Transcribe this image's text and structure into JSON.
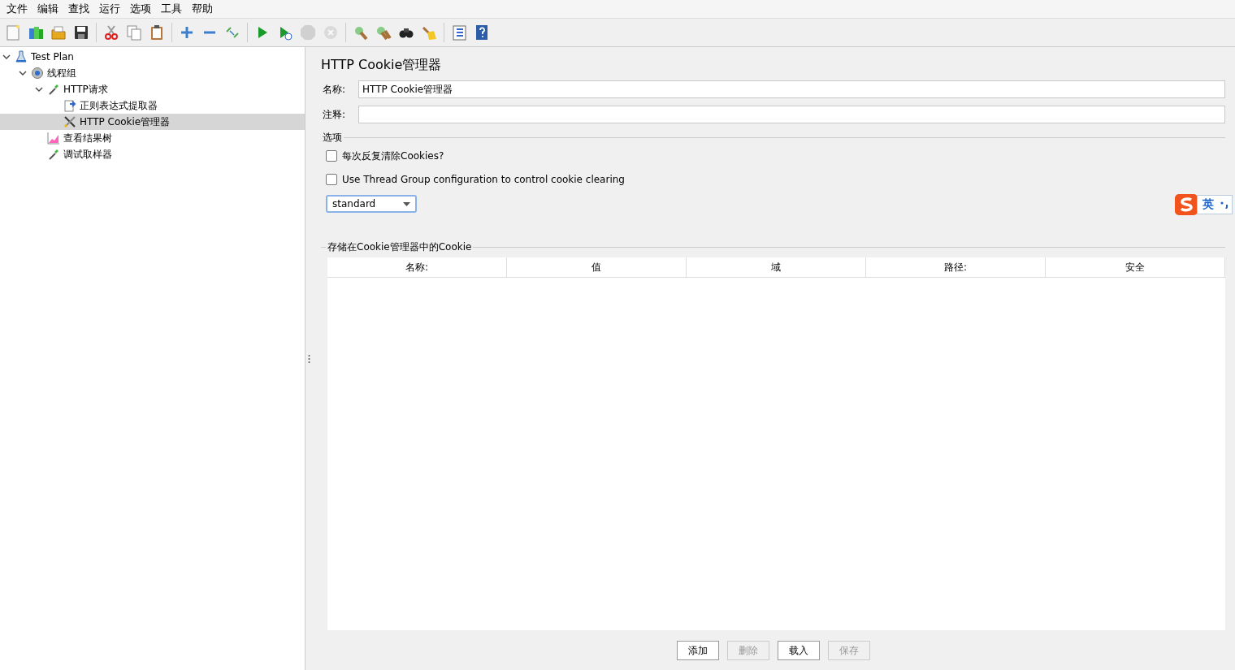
{
  "menu": [
    "文件",
    "编辑",
    "查找",
    "运行",
    "选项",
    "工具",
    "帮助"
  ],
  "toolbar": [
    {
      "kind": "new",
      "disabled": false
    },
    {
      "kind": "templates",
      "disabled": false
    },
    {
      "kind": "open",
      "disabled": false
    },
    {
      "kind": "save",
      "disabled": false
    },
    {
      "kind": "sep"
    },
    {
      "kind": "cut",
      "disabled": false
    },
    {
      "kind": "copy",
      "disabled": false
    },
    {
      "kind": "paste",
      "disabled": false
    },
    {
      "kind": "sep"
    },
    {
      "kind": "expand",
      "disabled": false
    },
    {
      "kind": "collapse",
      "disabled": false
    },
    {
      "kind": "toggle",
      "disabled": false
    },
    {
      "kind": "sep"
    },
    {
      "kind": "start",
      "disabled": false
    },
    {
      "kind": "start-no-pause",
      "disabled": false
    },
    {
      "kind": "stop",
      "disabled": true
    },
    {
      "kind": "shutdown",
      "disabled": true
    },
    {
      "kind": "sep"
    },
    {
      "kind": "clear",
      "disabled": false
    },
    {
      "kind": "clear-all",
      "disabled": false
    },
    {
      "kind": "search",
      "disabled": false
    },
    {
      "kind": "reset-search",
      "disabled": false
    },
    {
      "kind": "sep"
    },
    {
      "kind": "function",
      "disabled": false
    },
    {
      "kind": "help",
      "disabled": false
    }
  ],
  "tree": [
    {
      "label": "Test Plan",
      "kind": "flask",
      "expanded": true,
      "selected": false,
      "children": [
        {
          "label": "线程组",
          "kind": "gear",
          "expanded": true,
          "selected": false,
          "children": [
            {
              "label": "HTTP请求",
              "kind": "pipette",
              "expanded": true,
              "selected": false,
              "children": [
                {
                  "label": "正则表达式提取器",
                  "kind": "doc",
                  "selected": false
                },
                {
                  "label": "HTTP Cookie管理器",
                  "kind": "tools",
                  "selected": true
                }
              ]
            },
            {
              "label": "查看结果树",
              "kind": "graph",
              "selected": false
            },
            {
              "label": "调试取样器",
              "kind": "pipette",
              "selected": false
            }
          ]
        }
      ]
    }
  ],
  "panel": {
    "title": "HTTP Cookie管理器",
    "fields": [
      {
        "label": "名称:",
        "value": "HTTP Cookie管理器"
      },
      {
        "label": "注释:"
      }
    ],
    "options_title": "选项",
    "checkboxes": [
      {
        "label": "每次反复清除Cookies?",
        "checked": false
      },
      {
        "label": "Use Thread Group configuration to control cookie clearing",
        "checked": false
      }
    ],
    "policy": {
      "value": "standard"
    },
    "table": {
      "title": "存储在Cookie管理器中的Cookie",
      "columns": [
        "名称:",
        "值",
        "域",
        "路径:",
        "安全"
      ]
    },
    "buttons": [
      {
        "label": "添加",
        "disabled": false
      },
      {
        "label": "删除",
        "disabled": true
      },
      {
        "label": "载入",
        "disabled": false
      },
      {
        "label": "保存",
        "disabled": true
      }
    ]
  },
  "ime": {
    "mode": "英"
  }
}
